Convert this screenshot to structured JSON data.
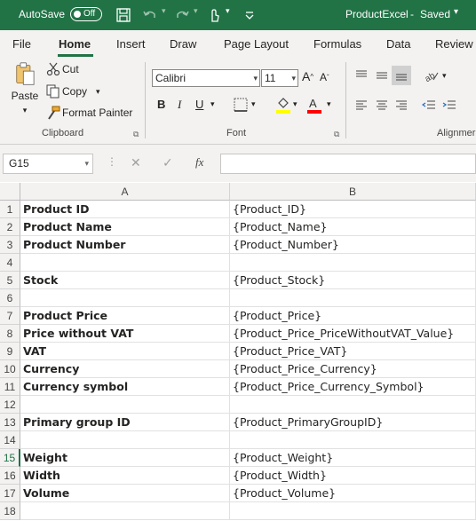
{
  "titlebar": {
    "autosave_label": "AutoSave",
    "autosave_state": "Off",
    "file_name": "ProductExcel",
    "separator": "-",
    "save_status": "Saved"
  },
  "tabs": [
    "File",
    "Home",
    "Insert",
    "Draw",
    "Page Layout",
    "Formulas",
    "Data",
    "Review"
  ],
  "ribbon": {
    "clipboard": {
      "paste": "Paste",
      "cut": "Cut",
      "copy": "Copy",
      "format_painter": "Format Painter",
      "group_label": "Clipboard"
    },
    "font": {
      "font_name": "Calibri",
      "font_size": "11",
      "bold": "B",
      "italic": "I",
      "underline": "U",
      "group_label": "Font"
    },
    "alignment": {
      "group_label": "Alignmer"
    }
  },
  "formula_bar": {
    "name_box": "G15",
    "fx": "fx",
    "content": ""
  },
  "sheet": {
    "columns": [
      "A",
      "B"
    ],
    "rows": [
      {
        "n": "1",
        "a": "Product ID",
        "b": "{Product_ID}"
      },
      {
        "n": "2",
        "a": "Product Name",
        "b": "{Product_Name}"
      },
      {
        "n": "3",
        "a": "Product Number",
        "b": "{Product_Number}"
      },
      {
        "n": "4",
        "a": "",
        "b": ""
      },
      {
        "n": "5",
        "a": "Stock",
        "b": "{Product_Stock}"
      },
      {
        "n": "6",
        "a": "",
        "b": ""
      },
      {
        "n": "7",
        "a": "Product Price",
        "b": "{Product_Price}"
      },
      {
        "n": "8",
        "a": "Price without VAT",
        "b": "{Product_Price_PriceWithoutVAT_Value}"
      },
      {
        "n": "9",
        "a": "VAT",
        "b": "{Product_Price_VAT}"
      },
      {
        "n": "10",
        "a": "Currency",
        "b": "{Product_Price_Currency}"
      },
      {
        "n": "11",
        "a": "Currency symbol",
        "b": "{Product_Price_Currency_Symbol}"
      },
      {
        "n": "12",
        "a": "",
        "b": ""
      },
      {
        "n": "13",
        "a": "Primary group ID",
        "b": "{Product_PrimaryGroupID}"
      },
      {
        "n": "14",
        "a": "",
        "b": ""
      },
      {
        "n": "15",
        "a": "Weight",
        "b": "{Product_Weight}"
      },
      {
        "n": "16",
        "a": "Width",
        "b": "{Product_Width}"
      },
      {
        "n": "17",
        "a": "Volume",
        "b": "{Product_Volume}"
      },
      {
        "n": "18",
        "a": "",
        "b": ""
      }
    ],
    "selected_row": "15"
  },
  "colors": {
    "accent": "#217346",
    "ribbon_bg": "#f3f2f1",
    "fill_highlight": "#ffff00",
    "font_color": "#ff0000"
  }
}
